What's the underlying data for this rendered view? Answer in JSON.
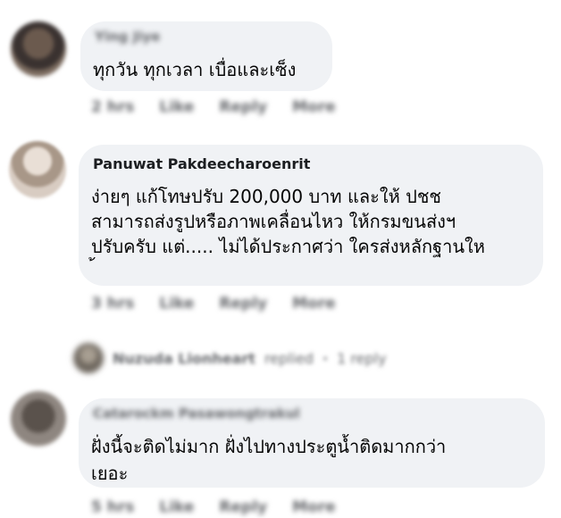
{
  "comments": [
    {
      "author": "Ying Jiye",
      "lines": [
        "ทุกวัน ทุกเวลา เบื่อและเซ็ง"
      ],
      "actions": [
        "2 hrs",
        "Like",
        "Reply",
        "More"
      ]
    },
    {
      "author": "Panuwat Pakdeecharoenrit",
      "lines": [
        "ง่ายๆ แก้โทษปรับ 200,000 บาท และให้ ปชช",
        "สามารถส่งรูปหรือภาพเคลื่อนไหว ให้กรมขนส่งฯ",
        "ปรับครับ แต่..... ไม่ได้ประกาศว่า ใครส่งหลักฐานให",
        "้"
      ],
      "actions": [
        "3 hrs",
        "Like",
        "Reply",
        "More"
      ]
    },
    {
      "author": "Catarockm Pasawongtrakul",
      "lines": [
        "ฝั่งนี้จะติดไม่มาก ฝั่งไปทางประตูน้ำติดมากกว่า",
        "เยอะ"
      ],
      "actions": [
        "5 hrs",
        "Like",
        "Reply",
        "More"
      ]
    }
  ],
  "reply_summary": {
    "name": "Nuzuda Lionheart",
    "verb": "replied",
    "count": "1 reply"
  }
}
